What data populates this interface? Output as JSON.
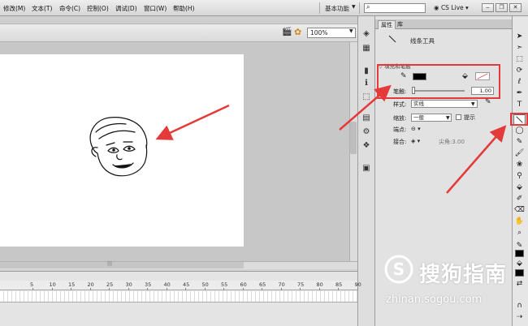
{
  "menubar": {
    "items": [
      "修改(M)",
      "文本(T)",
      "命令(C)",
      "控制(O)",
      "调试(D)",
      "窗口(W)",
      "帮助(H)"
    ],
    "workspace": "基本功能",
    "cs_live": "CS Live"
  },
  "stage": {
    "zoom": "100%"
  },
  "timeline": {
    "ticks": [
      "5",
      "10",
      "15",
      "20",
      "25",
      "30",
      "35",
      "40",
      "45",
      "50",
      "55",
      "60",
      "65",
      "70",
      "75",
      "80",
      "85",
      "90"
    ]
  },
  "properties": {
    "tabs": [
      "属性",
      "库"
    ],
    "tool_name": "线条工具",
    "section": "填充和笔触",
    "stroke_label": "笔触:",
    "stroke_value": "1.00",
    "style_label": "样式:",
    "style_value": "实线",
    "scale_label": "缩放:",
    "scale_value": "一般",
    "hint_label": "提示",
    "cap_label": "端点:",
    "join_label": "接合:",
    "miter_label": "尖角:",
    "miter_value": "3.00"
  },
  "colors": {
    "annotation": "#e53a3a",
    "stroke": "#000000"
  },
  "watermark": {
    "brand": "搜狗指南",
    "url": "zhinan.sogou.com"
  }
}
